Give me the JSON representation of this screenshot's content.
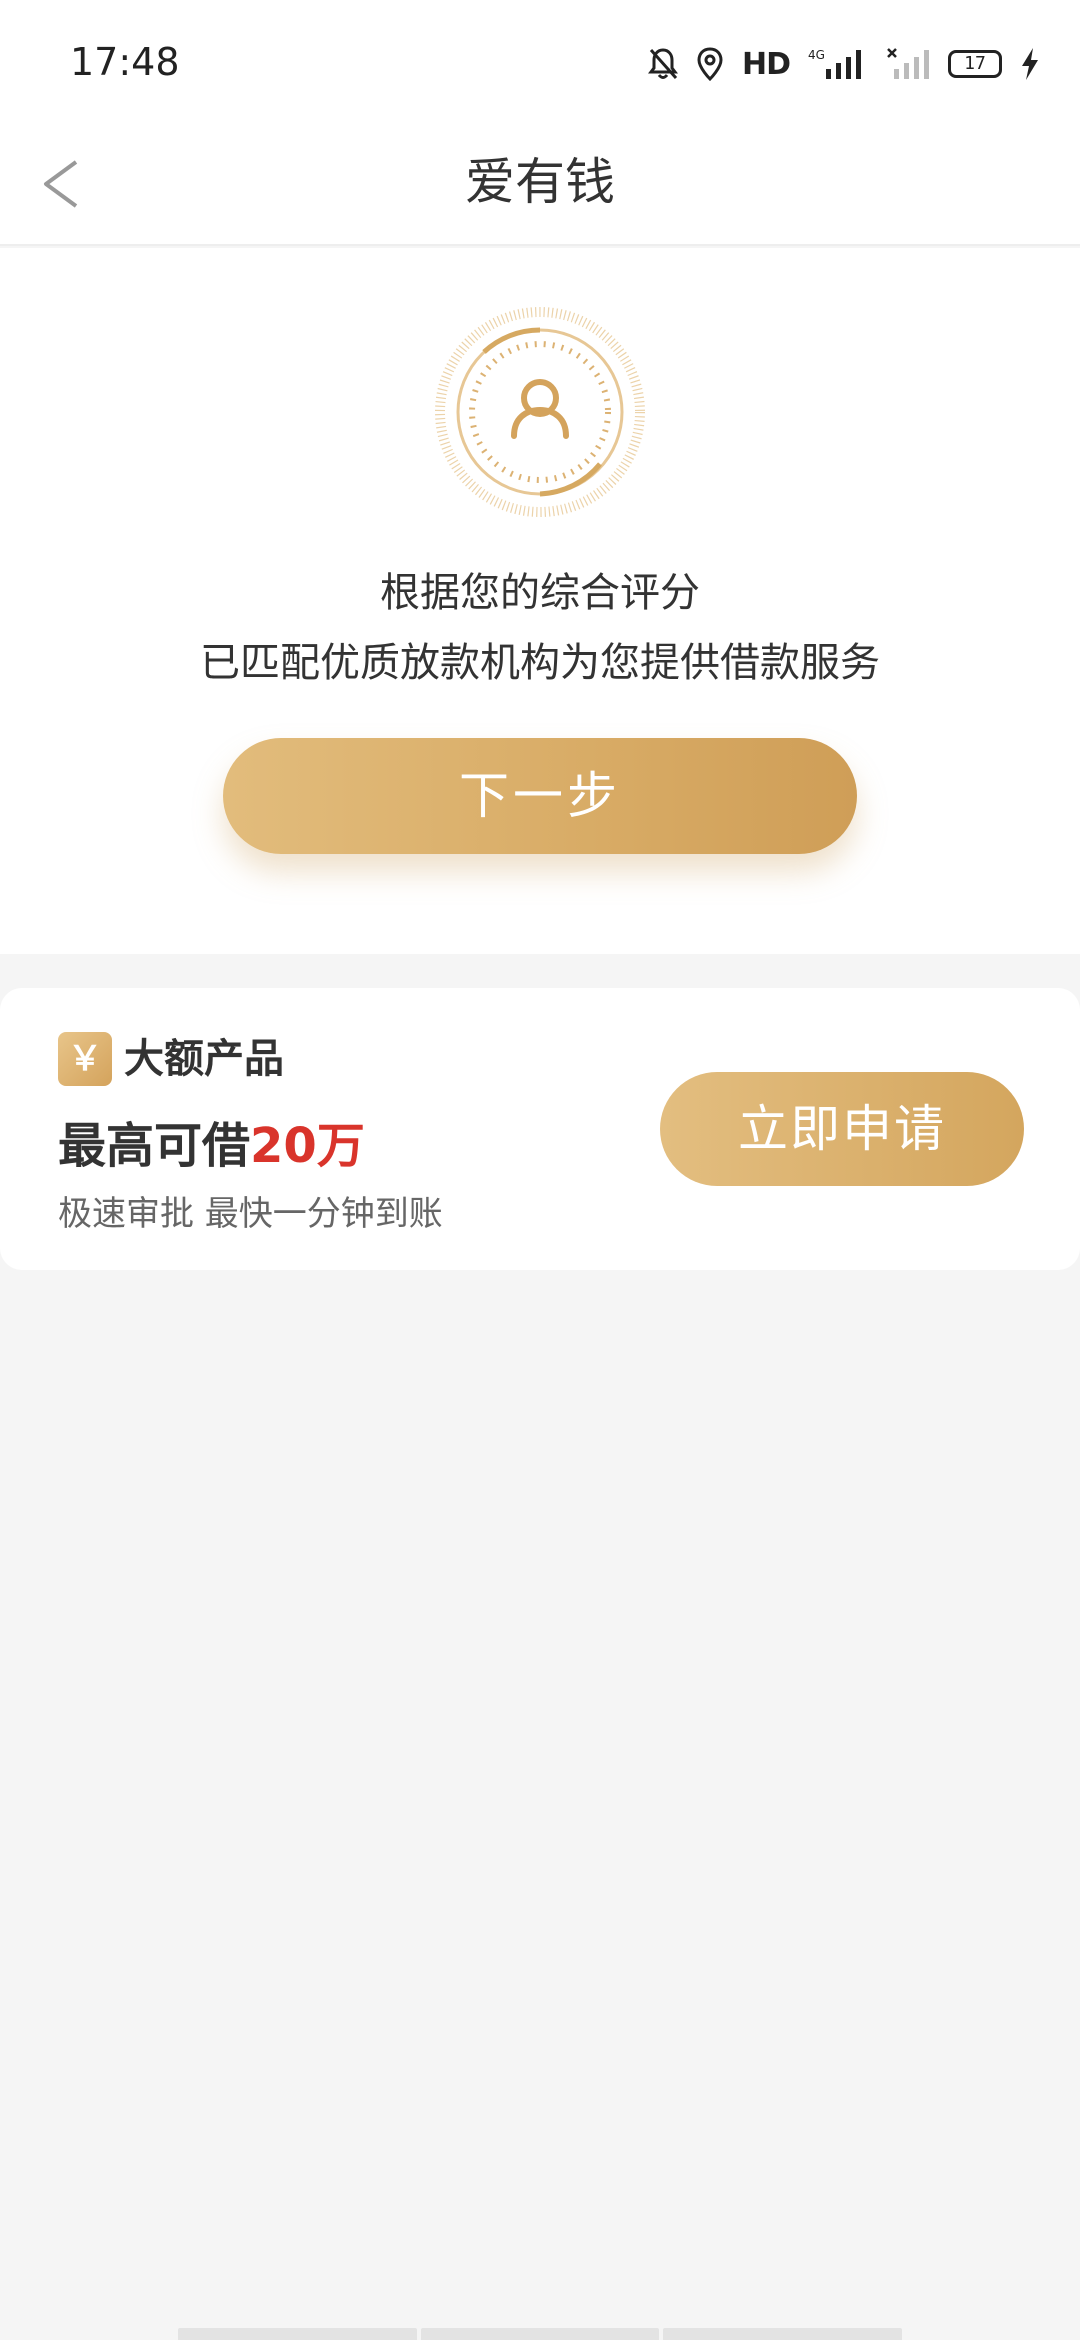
{
  "status_bar": {
    "time": "17:48",
    "network_label": "HD",
    "network_sub": "4G",
    "battery": "17",
    "icons": [
      "bell-off-icon",
      "location-icon",
      "hd-icon",
      "signal-4g-icon",
      "signal-noservice-icon",
      "battery-icon",
      "charging-icon"
    ]
  },
  "navbar": {
    "title": "爱有钱",
    "back_icon": "chevron-left-icon"
  },
  "hero": {
    "icon": "user-dial-icon",
    "line1": "根据您的综合评分",
    "line2": "已匹配优质放款机构为您提供借款服务",
    "next_label": "下一步"
  },
  "product": {
    "badge": "￥",
    "tag": "大额产品",
    "max_prefix": "最高可借",
    "max_amount": "20万",
    "subtitle": "极速审批 最快一分钟到账",
    "apply_label": "立即申请"
  },
  "colors": {
    "gold": "#d8ab65",
    "red": "#d9342b",
    "background": "#f5f5f5"
  }
}
